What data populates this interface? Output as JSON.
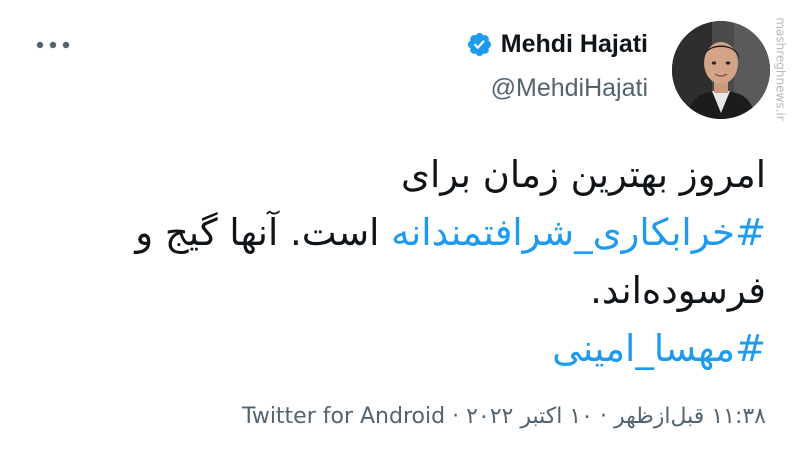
{
  "author": {
    "display_name": "Mehdi Hajati",
    "handle": "@MehdiHajati",
    "verified_icon": "verified-badge-icon",
    "avatar_icon": "profile-photo"
  },
  "watermark": "mashreghnews.ir",
  "menu": {
    "more_icon": "more-options-icon"
  },
  "tweet": {
    "line1": "امروز بهترین زمان برای",
    "hashtag1": "#خرابکاری_شرافتمندانه",
    "line2_rest": " است. آنها گیج و",
    "line3": "فرسوده‌اند.",
    "hashtag2": "#مهسا_امینی"
  },
  "meta": {
    "time": "۱۱:۳۸ قبل‌ازظهر",
    "separator": "·",
    "date": "۱۰ اکتبر ۲۰۲۲",
    "source": "Twitter for Android"
  },
  "colors": {
    "link": "#1d9bf0",
    "text": "#0f1419",
    "secondary": "#536471",
    "verified": "#1d9bf0"
  }
}
